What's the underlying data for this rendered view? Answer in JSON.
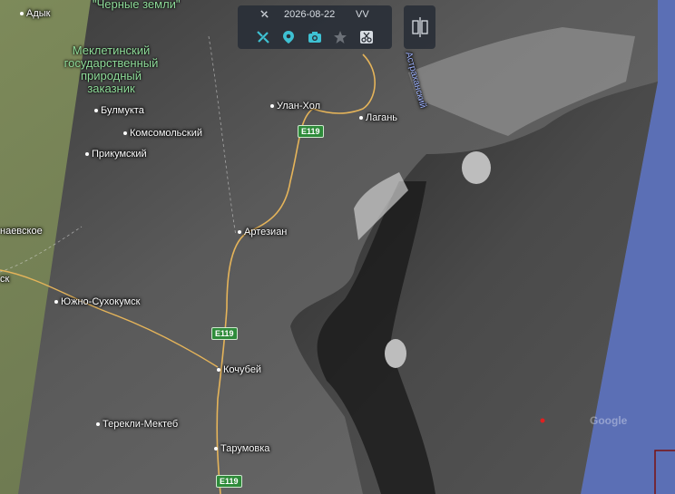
{
  "toolbar": {
    "date": "2026-08-22",
    "polarization": "VV",
    "icons": [
      "satellite-icon",
      "location-icon",
      "camera-icon",
      "star-icon",
      "scissors-icon"
    ],
    "accent_color": "#3ec1d3"
  },
  "split_view": {
    "icon": "split-view-icon"
  },
  "labels": {
    "adyk": "Адык",
    "chernye_zemli": "\"Черные земли\"",
    "reserve": [
      "Меклетинский",
      "государственный",
      "природный",
      "заказник"
    ],
    "bulmukta": "Булмукта",
    "komsomolsky": "Комсомольский",
    "prikumsky": "Прикумский",
    "ulan_khol": "Улан-Хол",
    "lagan": "Лагань",
    "artezian": "Артезиан",
    "naevskoe": "наевское",
    "sk": "ск",
    "yuzhno_sukhokumsk": "Южно-Сухокумск",
    "kochubey": "Кочубей",
    "terekli_mekteb": "Терекли-Мектеб",
    "tarumovka": "Тарумовка",
    "astrakhan_zapovednik": "Астраханский",
    "google": "Google"
  },
  "roads": [
    "E119",
    "E119",
    "E119"
  ],
  "colors": {
    "sea_blue": "#5b6fb5",
    "road": "#e5b45a",
    "reserve_text": "#8fdc9a"
  }
}
